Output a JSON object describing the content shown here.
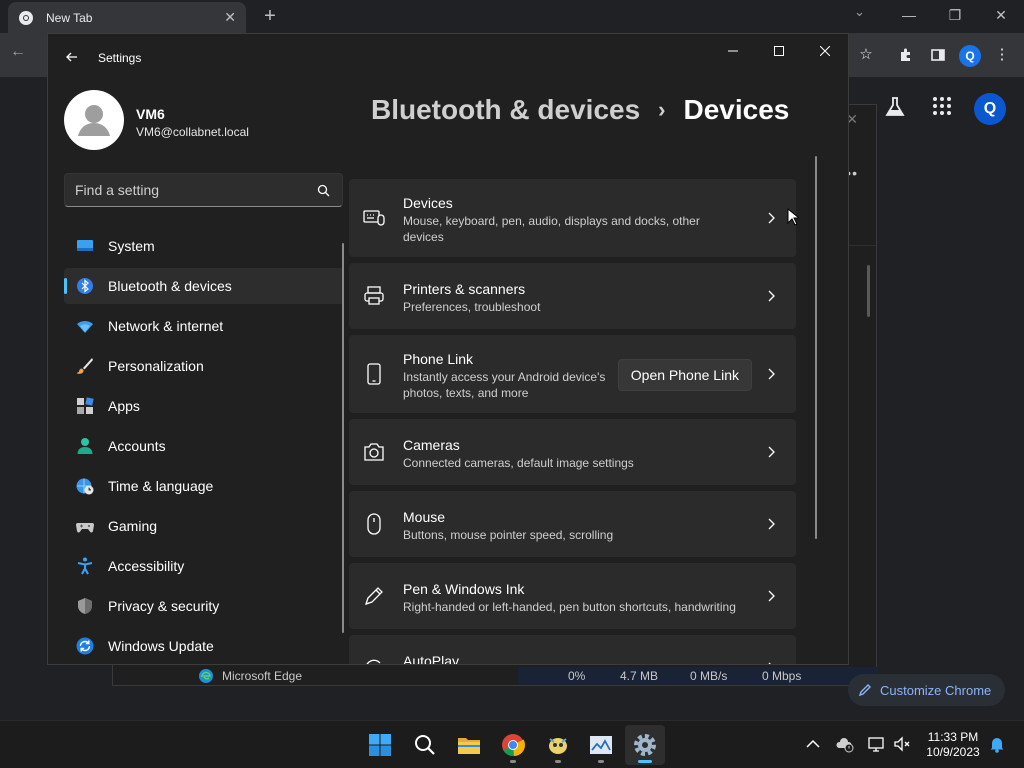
{
  "chrome": {
    "tab_title": "New Tab",
    "customize_label": "Customize Chrome",
    "profile_initial": "Q"
  },
  "taskmgr": {
    "process_name": "Microsoft Edge",
    "cpu": "0%",
    "memory": "4.7 MB",
    "disk": "0 MB/s",
    "network": "0 Mbps"
  },
  "settings": {
    "window_title": "Settings",
    "user": {
      "name": "VM6",
      "email": "VM6@collabnet.local"
    },
    "search_placeholder": "Find a setting",
    "nav": [
      {
        "label": "System",
        "icon": "system-icon"
      },
      {
        "label": "Bluetooth & devices",
        "icon": "bluetooth-icon"
      },
      {
        "label": "Network & internet",
        "icon": "wifi-icon"
      },
      {
        "label": "Personalization",
        "icon": "brush-icon"
      },
      {
        "label": "Apps",
        "icon": "apps-icon"
      },
      {
        "label": "Accounts",
        "icon": "accounts-icon"
      },
      {
        "label": "Time & language",
        "icon": "globe-clock-icon"
      },
      {
        "label": "Gaming",
        "icon": "gamepad-icon"
      },
      {
        "label": "Accessibility",
        "icon": "accessibility-icon"
      },
      {
        "label": "Privacy & security",
        "icon": "shield-icon"
      },
      {
        "label": "Windows Update",
        "icon": "update-icon"
      }
    ],
    "active_nav": "Bluetooth & devices",
    "breadcrumb": {
      "parent": "Bluetooth & devices",
      "current": "Devices"
    },
    "cards": [
      {
        "title": "Devices",
        "description": "Mouse, keyboard, pen, audio, displays and docks, other devices",
        "icon": "devices-icon"
      },
      {
        "title": "Printers & scanners",
        "description": "Preferences, troubleshoot",
        "icon": "printer-icon"
      },
      {
        "title": "Phone Link",
        "description": "Instantly access your Android device's photos, texts, and more",
        "icon": "phone-icon",
        "button": "Open Phone Link"
      },
      {
        "title": "Cameras",
        "description": "Connected cameras, default image settings",
        "icon": "camera-icon"
      },
      {
        "title": "Mouse",
        "description": "Buttons, mouse pointer speed, scrolling",
        "icon": "mouse-icon"
      },
      {
        "title": "Pen & Windows Ink",
        "description": "Right-handed or left-handed, pen button shortcuts, handwriting",
        "icon": "pen-icon"
      },
      {
        "title": "AutoPlay",
        "description": "",
        "icon": "autoplay-icon"
      }
    ]
  },
  "taskbar": {
    "apps": [
      "start-icon",
      "search-icon",
      "file-explorer-icon",
      "chrome-icon",
      "ai-app-icon",
      "task-manager-icon",
      "settings-icon"
    ],
    "time": "11:33 PM",
    "date": "10/9/2023"
  },
  "colors": {
    "accent": "#4cc2ff",
    "window_bg": "#202020",
    "card_bg": "#2b2b2b"
  }
}
